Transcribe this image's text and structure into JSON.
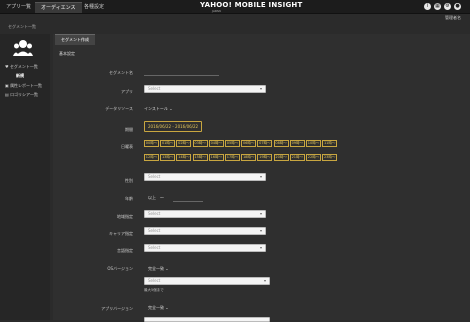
{
  "header": {
    "tabs": [
      "アプリ一覧",
      "オーディエンス",
      "各種設定"
    ],
    "active_tab": 1,
    "brand": "YAHOO! MOBILE INSIGHT",
    "brand_sub": "JAPAN",
    "user_label": "管理者名"
  },
  "breadcrumb": "セグメント一覧",
  "sidebar": {
    "items": [
      {
        "label": "セグメント一覧",
        "icon": "heart-icon"
      },
      {
        "label": "新規",
        "sub": true
      },
      {
        "label": "属性レポート一覧",
        "icon": "report-icon"
      },
      {
        "label": "ロゴリシア一覧",
        "icon": "list-icon"
      }
    ]
  },
  "main": {
    "tab": "セグメント作成",
    "section": "基本設定",
    "fields": {
      "segment_name": {
        "label": "セグメント名",
        "value": ""
      },
      "app": {
        "label": "アプリ",
        "placeholder": "Select"
      },
      "data_source": {
        "label": "データリソース",
        "value": "インストール"
      },
      "period": {
        "label": "期間",
        "value": "2016/06/22 - 2016/06/22"
      },
      "timeslot": {
        "label": "日曜表",
        "hours_row1": [
          "00時～",
          "01時～",
          "02時～",
          "03時～",
          "04時～",
          "05時～",
          "06時～",
          "07時～",
          "08時～",
          "09時～",
          "10時～",
          "11時～"
        ],
        "hours_row2": [
          "12時～",
          "13時～",
          "14時～",
          "15時～",
          "16時～",
          "17時～",
          "18時～",
          "19時～",
          "20時～",
          "21時～",
          "22時～",
          "23時～"
        ]
      },
      "gender": {
        "label": "性別",
        "placeholder": "Select"
      },
      "age": {
        "label": "年齢",
        "prefix": "以上",
        "suffix": "～"
      },
      "region": {
        "label": "地域指定",
        "placeholder": "Select"
      },
      "carrier": {
        "label": "キャリア指定",
        "placeholder": "Select"
      },
      "language": {
        "label": "言語指定",
        "placeholder": "Select"
      },
      "os_version": {
        "label": "OSバージョン",
        "mode": "完全一致",
        "placeholder": "Select",
        "note": "最大5個まで"
      },
      "app_version": {
        "label": "アプリバージョン",
        "mode": "完全一致"
      }
    }
  }
}
